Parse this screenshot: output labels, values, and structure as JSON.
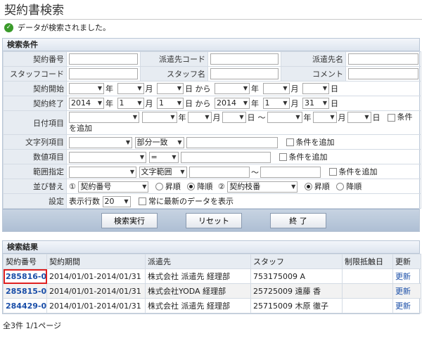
{
  "page": {
    "title": "契約書検索",
    "message": "データが検索されました。"
  },
  "conditions": {
    "header": "検索条件",
    "contract_no_label": "契約番号",
    "dispatch_code_label": "派遣先コード",
    "dispatch_name_label": "派遣先名",
    "staff_code_label": "スタッフコード",
    "staff_name_label": "スタッフ名",
    "comment_label": "コメント",
    "start_label": "契約開始",
    "end_label": "契約終了",
    "year_unit": "年",
    "month_unit": "月",
    "day_unit": "日",
    "from_text": "日 から",
    "end_values": {
      "y1": "2014",
      "m1": "1",
      "d1": "1",
      "y2": "2014",
      "m2": "1",
      "d2": "31"
    },
    "date_item_label": "日付項目",
    "tilde": "～",
    "add_condition": "条件を追加",
    "add_condition_wrap": "を追加",
    "condition_prefix": "条件",
    "string_item_label": "文字列項目",
    "match_value": "部分一致",
    "numeric_item_label": "数値項目",
    "equals_value": "=",
    "range_label": "範囲指定",
    "range_value": "文字範囲",
    "sort_label": "並び替え",
    "sort1_no": "①",
    "sort1_value": "契約番号",
    "asc": "昇順",
    "desc": "降順",
    "sort2_no": "②",
    "sort2_value": "契約枝番",
    "settings_label": "設定",
    "rows_label": "表示行数",
    "rows_value": "20",
    "latest_label": "常に最新のデータを表示"
  },
  "buttons": {
    "search": "検索実行",
    "reset": "リセット",
    "exit": "終 了"
  },
  "results": {
    "header": "検索結果",
    "columns": [
      "契約番号",
      "契約期間",
      "派遣先",
      "スタッフ",
      "制限抵触日",
      "更新"
    ],
    "rows": [
      {
        "id": "285816-0",
        "period": "2014/01/01-2014/01/31",
        "dispatch": "株式会社 派遣先 経理部",
        "staff": "753175009 A",
        "limit": "",
        "update": "更新"
      },
      {
        "id": "285815-0",
        "period": "2014/01/01-2014/01/31",
        "dispatch": "株式会社YODA 経理部",
        "staff": "25725009 遠藤 香",
        "limit": "",
        "update": "更新"
      },
      {
        "id": "284429-0",
        "period": "2014/01/01-2014/01/31",
        "dispatch": "株式会社 派遣先 経理部",
        "staff": "25715009 木原 徹子",
        "limit": "",
        "update": "更新"
      }
    ],
    "footer": "全3件 1/1ページ"
  }
}
